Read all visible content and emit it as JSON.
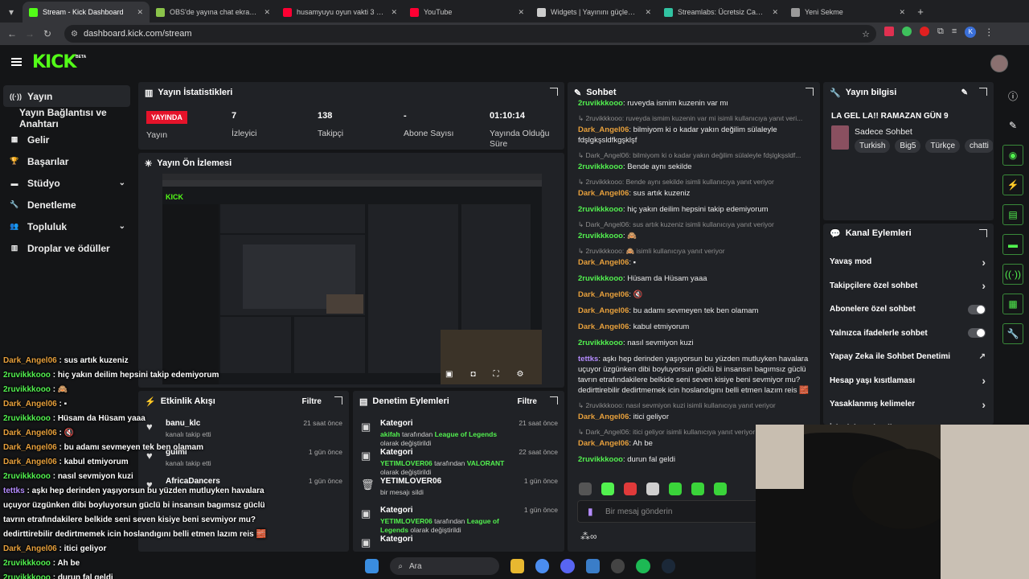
{
  "browser": {
    "tabs": [
      {
        "title": "Stream - Kick Dashboard",
        "color": "#53fc18",
        "active": true
      },
      {
        "title": "OBS'de yayına chat ekranı nasıl",
        "color": "#8ac34a",
        "active": false
      },
      {
        "title": "husamyuyu oyun vakti 3 - Y",
        "color": "#ff0033",
        "active": false
      },
      {
        "title": "YouTube",
        "color": "#ff0033",
        "active": false
      },
      {
        "title": "Widgets | Yayınını güçlendirmek",
        "color": "#cccccc",
        "active": false
      },
      {
        "title": "Streamlabs: Ücretsiz Canlı Yayı",
        "color": "#31c3a2",
        "active": false
      },
      {
        "title": "Yeni Sekme",
        "color": "#999999",
        "active": false
      }
    ],
    "url": "dashboard.kick.com/stream"
  },
  "header": {
    "logo": "KICK",
    "beta": "BETA"
  },
  "sidebar": {
    "items": [
      {
        "label": "Yayın",
        "icon": "broadcast-icon",
        "active": true
      },
      {
        "label": "Yayın Bağlantısı ve Anahtarı",
        "icon": "",
        "active": false
      },
      {
        "label": "Gelir",
        "icon": "revenue-icon",
        "active": false
      },
      {
        "label": "Başarılar",
        "icon": "trophy-icon",
        "active": false
      },
      {
        "label": "Stüdyo",
        "icon": "studio-icon",
        "active": false,
        "chevron": true
      },
      {
        "label": "Denetleme",
        "icon": "wrench-icon",
        "active": false
      },
      {
        "label": "Topluluk",
        "icon": "community-icon",
        "active": false,
        "chevron": true
      },
      {
        "label": "Droplar ve ödüller",
        "icon": "drops-icon",
        "active": false
      }
    ]
  },
  "stats": {
    "title": "Yayın İstatistikleri",
    "live_badge": "YAYINDA",
    "live_label": "Yayın",
    "viewers_value": "7",
    "viewers_label": "İzleyici",
    "followers_value": "138",
    "followers_label": "Takipçi",
    "subs_value": "-",
    "subs_label": "Abone Sayısı",
    "uptime_value": "01:10:14",
    "uptime_label": "Yayında Olduğu Süre"
  },
  "preview": {
    "title": "Yayın Ön İzlemesi"
  },
  "activity": {
    "title": "Etkinlik Akışı",
    "filter": "Filtre",
    "items": [
      {
        "name": "banu_klc",
        "desc": "kanalı takip etti",
        "time": "21 saat önce"
      },
      {
        "name": "gulmi",
        "desc": "kanalı takip etti",
        "time": "1 gün önce"
      },
      {
        "name": "AfricaDancers",
        "desc": "",
        "time": "1 gün önce"
      }
    ]
  },
  "moderation": {
    "title": "Denetim Eylemleri",
    "filter": "Filtre",
    "items": [
      {
        "title": "Kategori",
        "user": "akifah",
        "mid": "tarafından",
        "target": "League of Legends",
        "tail": "olarak değiştirildi",
        "time": "21 saat önce"
      },
      {
        "title": "Kategori",
        "user": "YETIMLOVER06",
        "mid": "tarafından",
        "target": "VALORANT",
        "tail": "olarak değiştirildi",
        "time": "22 saat önce"
      },
      {
        "title": "YETIMLOVER06",
        "user": "",
        "mid": "bir mesajı sildi",
        "target": "",
        "tail": "",
        "time": "1 gün önce"
      },
      {
        "title": "Kategori",
        "user": "YETIMLOVER06",
        "mid": "tarafından",
        "target": "League of Legends",
        "tail": "olarak değiştirildi",
        "time": "1 gün önce"
      },
      {
        "title": "Kategori",
        "user": "",
        "mid": "",
        "target": "",
        "tail": "",
        "time": ""
      }
    ]
  },
  "chat": {
    "title": "Sohbet",
    "placeholder": "Bir mesaj gönderin",
    "messages": [
      {
        "reply": "",
        "user": "2ruvikkkooo",
        "color": "g",
        "text": "ruveyda ismim kuzenin var mı"
      },
      {
        "reply": "2ruvikkkooo: ruveyda ismim kuzenin var mi isimli kullanıcıya yanıt veri...",
        "user": "Dark_Angel06",
        "color": "o",
        "text": "bilmiyom ki o kadar yakın değilim sülaleyle fdşlgkşsldfkgşklşf"
      },
      {
        "reply": "Dark_Angel06: bilmiyom ki o kadar yakın değilim sülaleyle fdşlgkşsldf...",
        "user": "2ruvikkkooo",
        "color": "g",
        "text": "Bende aynı sekilde"
      },
      {
        "reply": "2ruvikkkooo: Bende aynı sekilde isimli kullanıcıya yanıt veriyor",
        "user": "Dark_Angel06",
        "color": "o",
        "text": "sus artık kuzeniz"
      },
      {
        "reply": "",
        "user": "2ruvikkkooo",
        "color": "g",
        "text": "hiç yakın deilim hepsini takip edemiyorum"
      },
      {
        "reply": "Dark_Angel06: sus artık kuzeniz isimli kullanıcıya yanıt veriyor",
        "user": "2ruvikkkooo",
        "color": "g",
        "text": "🙈"
      },
      {
        "reply": "2ruvikkkooo: 🙈 isimli kullanıcıya yanıt veriyor",
        "user": "Dark_Angel06",
        "color": "o",
        "text": "▪"
      },
      {
        "reply": "",
        "user": "2ruvikkkooo",
        "color": "g",
        "text": "Hüsam da Hüsam yaaa"
      },
      {
        "reply": "",
        "user": "Dark_Angel06",
        "color": "o",
        "text": "🔇"
      },
      {
        "reply": "",
        "user": "Dark_Angel06",
        "color": "o",
        "text": "bu adamı sevmeyen tek ben olamam"
      },
      {
        "reply": "",
        "user": "Dark_Angel06",
        "color": "o",
        "text": "kabul etmiyorum"
      },
      {
        "reply": "",
        "user": "2ruvikkkooo",
        "color": "g",
        "text": "nasıl sevmiyon kuzi"
      },
      {
        "reply": "",
        "user": "tettks",
        "color": "p",
        "text": "aşkı hep derinden yaşıyorsun bu yüzden mutluyken havalara uçuyor üzgünken dibi boyluyorsun güclü bi insansın bagımsız güclü tavrın etrafındakilere belkide seni seven kisiye beni sevmiyor mu? dedirttirebilir dedirtmemek icin hoslandıgını belli etmen lazım reis 🧱"
      },
      {
        "reply": "2ruvikkkooo: nasıl sevmiyon kuzi isimli kullanıcıya yanıt veriyor",
        "user": "Dark_Angel06",
        "color": "o",
        "text": "itici geliyor"
      },
      {
        "reply": "Dark_Angel06: itici geliyor isimli kullanıcıya yanıt veriyor",
        "user": "Dark_Angel06",
        "color": "o",
        "text": "Ah be"
      },
      {
        "reply": "",
        "user": "2ruvikkkooo",
        "color": "g",
        "text": "durun fal geldi"
      }
    ]
  },
  "stream_info": {
    "title": "Yayın bilgisi",
    "stream_title": "LA GEL LA!! RAMAZAN GÜN 9",
    "category": "Sadece Sohbet",
    "tags": [
      "Turkish",
      "Big5",
      "Türkçe",
      "chatti"
    ]
  },
  "channel_actions": {
    "title": "Kanal Eylemleri",
    "items": [
      {
        "label": "Yavaş mod",
        "kind": "arrow"
      },
      {
        "label": "Takipçilere özel sohbet",
        "kind": "arrow"
      },
      {
        "label": "Abonelere özel sohbet",
        "kind": "toggle"
      },
      {
        "label": "Yalnızca ifadelerle sohbet",
        "kind": "toggle"
      },
      {
        "label": "Yapay Zeka ile Sohbet Denetimi",
        "kind": "external"
      },
      {
        "label": "Hesap yaşı kısıtlaması",
        "kind": "arrow"
      },
      {
        "label": "Yasaklanmış kelimeler",
        "kind": "arrow"
      },
      {
        "label": "İzleyici Yönlendir",
        "kind": "arrow"
      }
    ]
  },
  "overlay_chat": [
    {
      "user": "Dark_Angel06",
      "color": "o",
      "text": "sus artık kuzeniz"
    },
    {
      "user": "2ruvikkkooo",
      "color": "g",
      "text": "hiç yakın deilim hepsini takip edemiyorum"
    },
    {
      "user": "2ruvikkkooo",
      "color": "g",
      "text": "🙈"
    },
    {
      "user": "Dark_Angel06",
      "color": "o",
      "text": "▪"
    },
    {
      "user": "2ruvikkkooo",
      "color": "g",
      "text": "Hüsam da Hüsam yaaa"
    },
    {
      "user": "Dark_Angel06",
      "color": "o",
      "text": "🔇"
    },
    {
      "user": "Dark_Angel06",
      "color": "o",
      "text": "bu adamı sevmeyen tek ben olamam"
    },
    {
      "user": "Dark_Angel06",
      "color": "o",
      "text": "kabul etmiyorum"
    },
    {
      "user": "2ruvikkkooo",
      "color": "g",
      "text": "nasıl sevmiyon kuzi"
    },
    {
      "user": "tettks",
      "color": "p",
      "text": "aşkı hep derinden yaşıyorsun bu yüzden mutluyken havalara uçuyor üzgünken dibi boyluyorsun güclü bi insansın bagımsız güclü tavrın etrafındakilere belkide seni seven kisiye beni sevmiyor mu? dedirttirebilir dedirtmemek icin hoslandıgını belli etmen lazım reis 🧱"
    },
    {
      "user": "Dark_Angel06",
      "color": "o",
      "text": "itici geliyor"
    },
    {
      "user": "2ruvikkkooo",
      "color": "g",
      "text": "Ah be"
    },
    {
      "user": "2ruvikkkooo",
      "color": "g",
      "text": "durun fal geldi"
    }
  ],
  "taskbar": {
    "search": "Ara"
  },
  "colors": {
    "kick_green": "#53fc18",
    "live_red": "#e5132a",
    "panel": "#202226"
  }
}
